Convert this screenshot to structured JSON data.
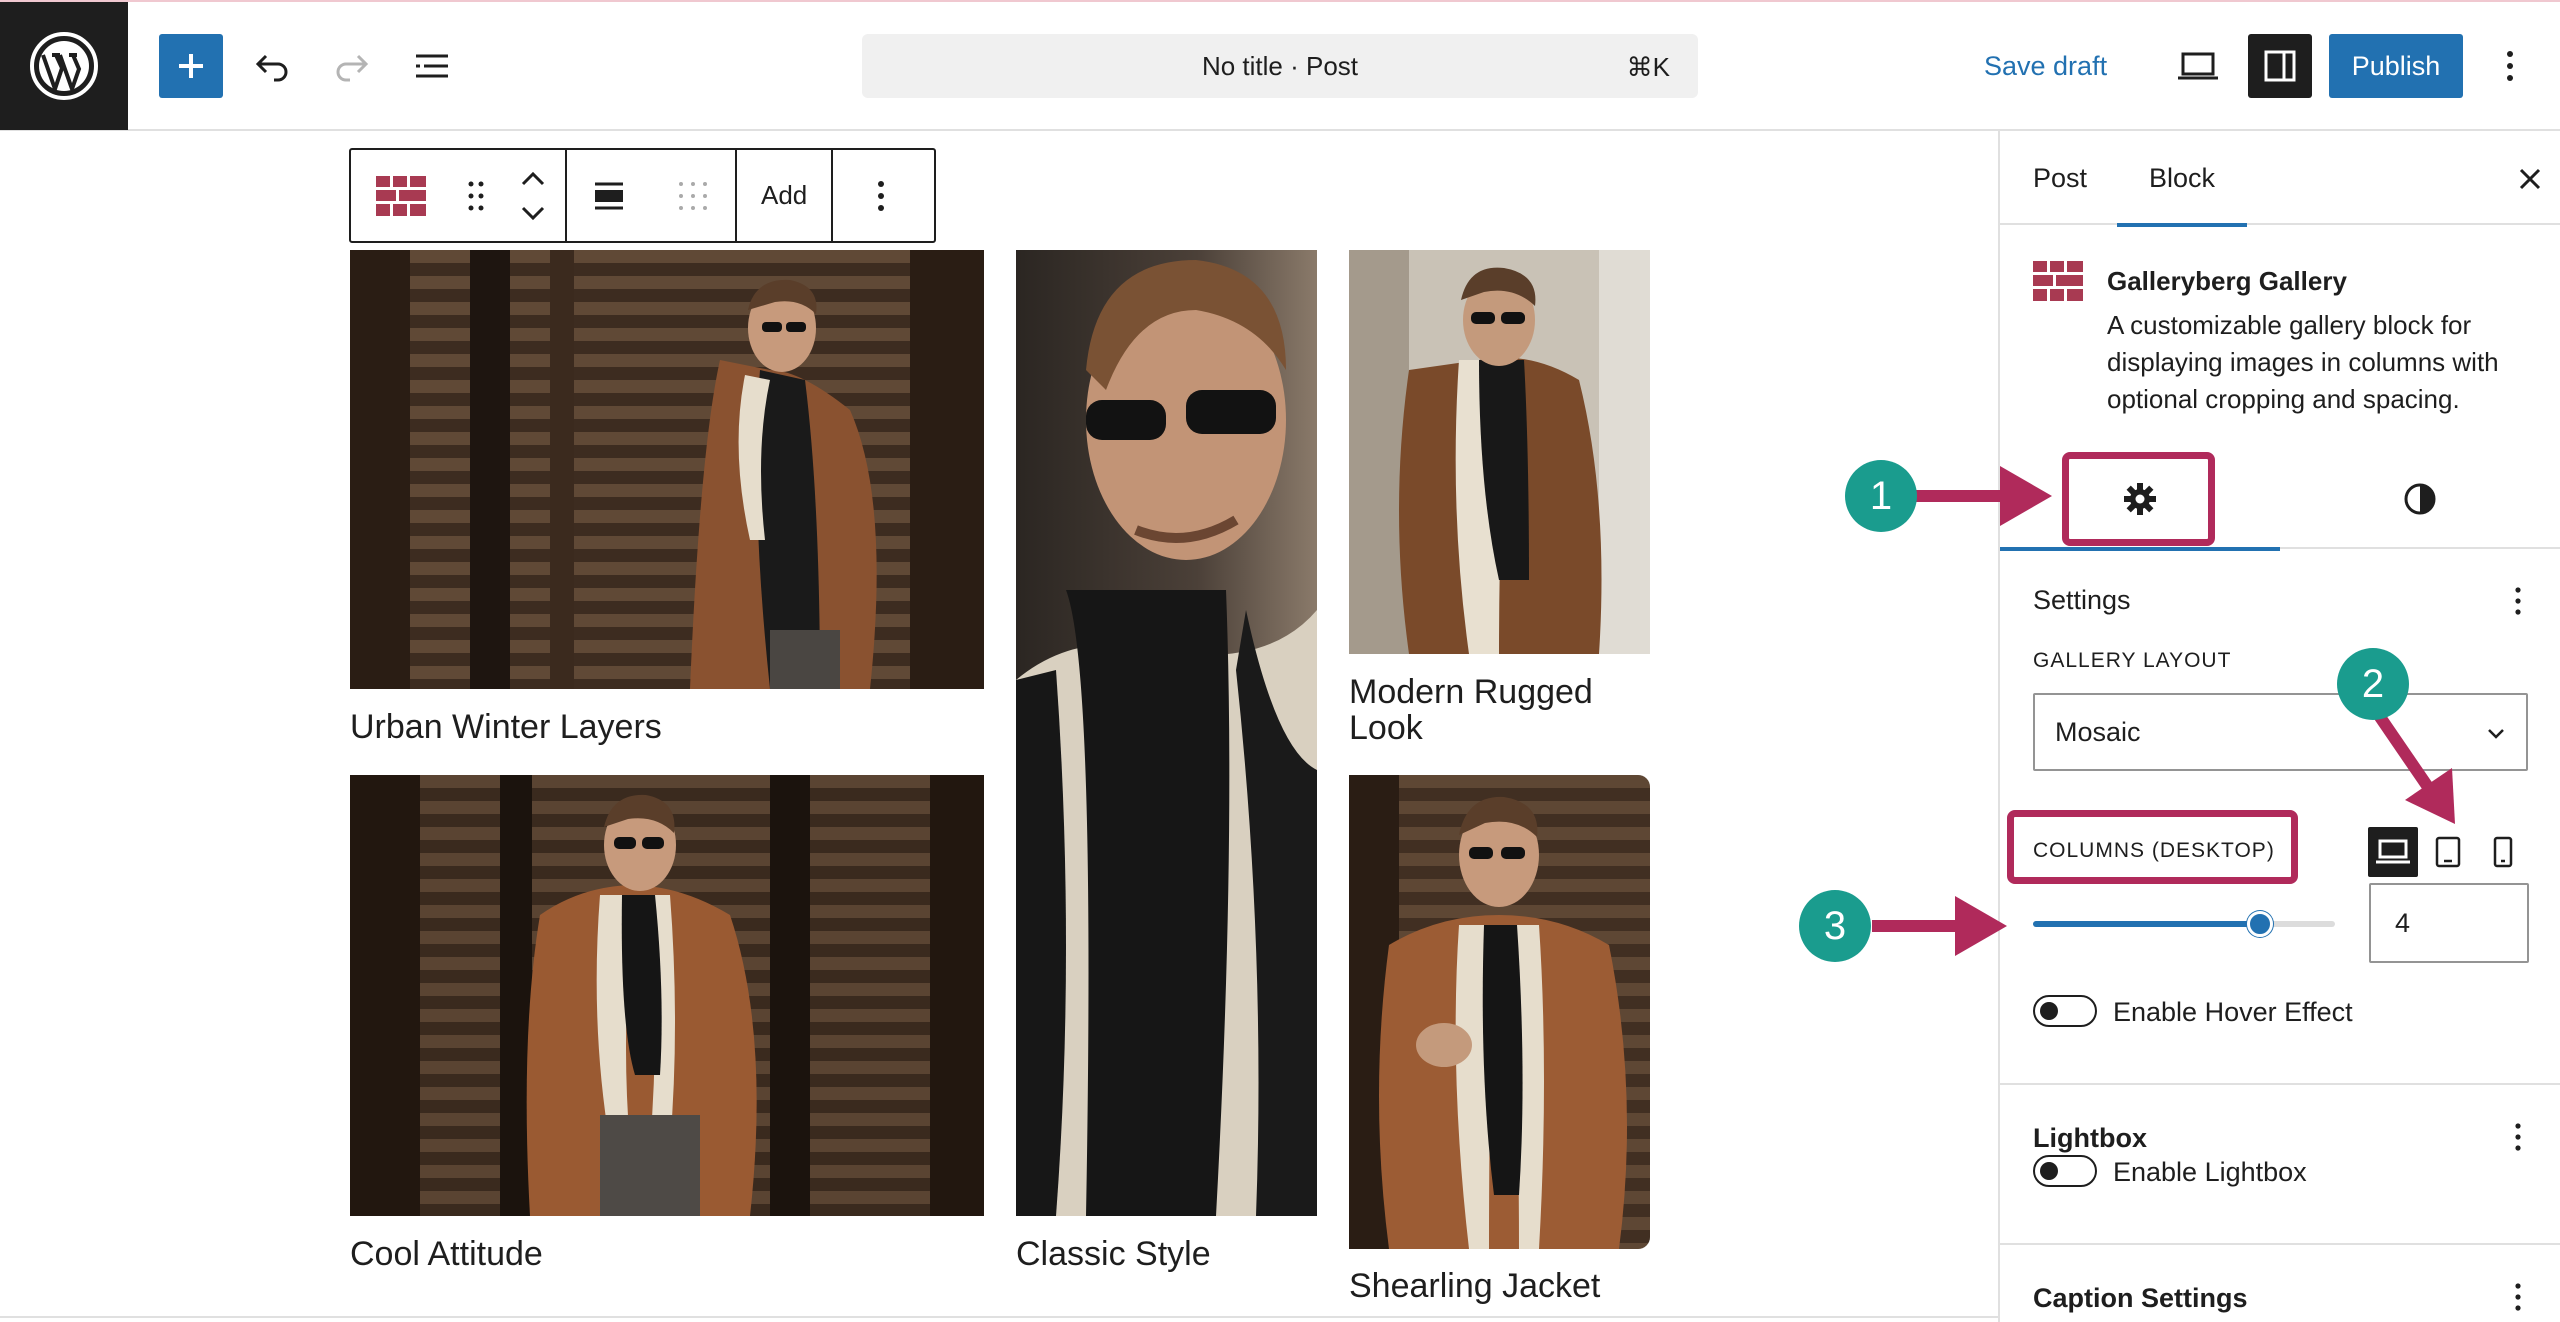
{
  "header": {
    "command_bar_text": "No title · Post",
    "command_shortcut": "⌘K",
    "save_draft_label": "Save draft",
    "publish_label": "Publish"
  },
  "block_toolbar": {
    "add_label": "Add"
  },
  "gallery": {
    "captions": [
      "Urban Winter Layers",
      "Classic Style",
      "Modern Rugged Look",
      "Cool Attitude",
      "Shearling Jacket"
    ]
  },
  "sidebar": {
    "tabs": [
      "Post",
      "Block"
    ],
    "active_tab": "Block",
    "block_card": {
      "title": "Galleryberg Gallery",
      "description": "A customizable gallery block for displaying images in columns with optional cropping and spacing."
    },
    "settings_panel": {
      "title": "Settings",
      "gallery_layout_label": "GALLERY LAYOUT",
      "gallery_layout_value": "Mosaic",
      "columns_label": "COLUMNS (DESKTOP)",
      "columns_value": "4",
      "columns_slider_fraction": 0.75,
      "hover_effect_label": "Enable Hover Effect"
    },
    "lightbox_panel": {
      "title": "Lightbox",
      "toggle_label": "Enable Lightbox"
    },
    "caption_panel": {
      "title": "Caption Settings"
    }
  },
  "annotations": {
    "badges": [
      "1",
      "2",
      "3"
    ]
  },
  "colors": {
    "accent": "#2271b1",
    "annotation_arrow": "#b02a5b",
    "annotation_badge": "#1a9c8e"
  }
}
